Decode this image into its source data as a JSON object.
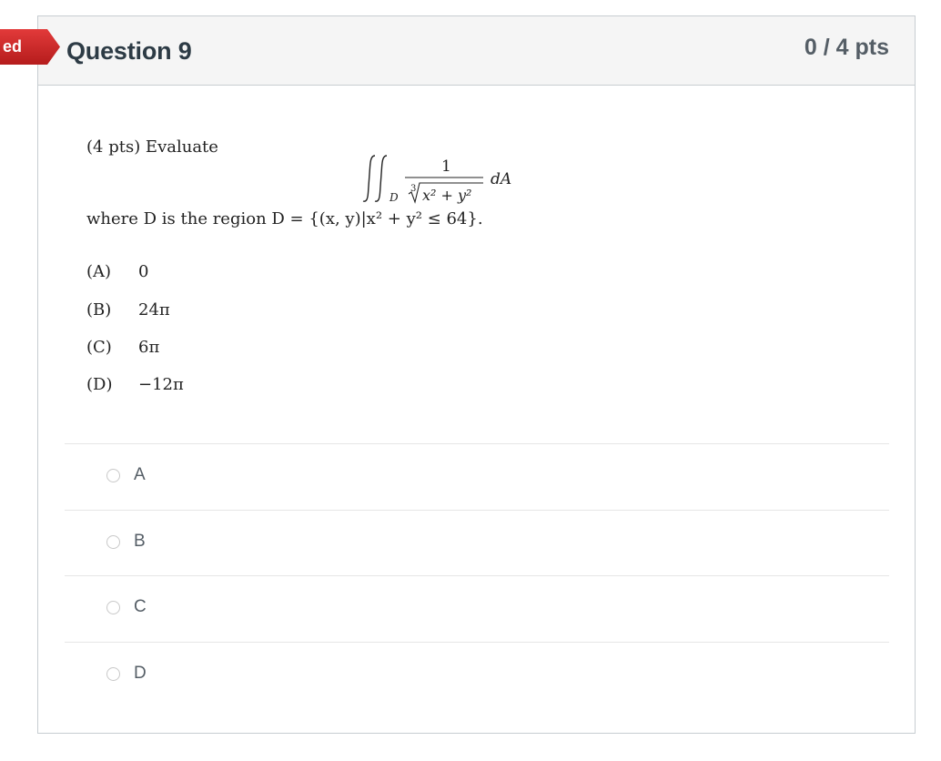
{
  "flag": {
    "text": "ed",
    "color": "#c21e25"
  },
  "question": {
    "title": "Question 9",
    "points": "0 / 4 pts",
    "intro": "(4 pts) Evaluate",
    "integral": {
      "numerator": "1",
      "root_index": "3",
      "radicand": "x² + y²",
      "subscript": "D",
      "differential": "dA"
    },
    "where_text": "where D is the region D = {(x, y)|x² + y² ≤ 64}.",
    "choices": [
      {
        "label": "(A)",
        "value": "0"
      },
      {
        "label": "(B)",
        "value": "24π"
      },
      {
        "label": "(C)",
        "value": "6π"
      },
      {
        "label": "(D)",
        "value": "−12π"
      }
    ]
  },
  "answers": [
    {
      "label": "A",
      "selected": false
    },
    {
      "label": "B",
      "selected": false
    },
    {
      "label": "C",
      "selected": false
    },
    {
      "label": "D",
      "selected": false
    }
  ]
}
